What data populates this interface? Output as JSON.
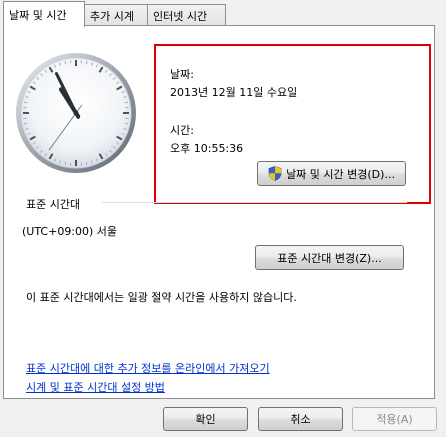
{
  "tabs": [
    {
      "label": "날짜 및 시간",
      "active": true
    },
    {
      "label": "추가 시계",
      "active": false
    },
    {
      "label": "인터넷 시간",
      "active": false
    }
  ],
  "datetime": {
    "date_label": "날짜:",
    "date_value": "2013년 12월 11일 수요일",
    "time_label": "시간:",
    "time_value": "오후 10:55:36",
    "change_button": "날짜 및 시간 변경(D)..."
  },
  "clock": {
    "hours": 10,
    "minutes": 55,
    "seconds": 36
  },
  "timezone": {
    "group_label": "표준 시간대",
    "value": "(UTC+09:00) 서울",
    "change_button": "표준 시간대 변경(Z)...",
    "dst_note": "이 표준 시간대에서는 일광 절약 시간을 사용하지 않습니다."
  },
  "links": [
    "표준 시간대에 대한 추가 정보를 온라인에서 가져오기",
    "시계 및 표준 시간대 설정 방법"
  ],
  "dialog_buttons": {
    "ok": "확인",
    "cancel": "취소",
    "apply": "적용(A)"
  },
  "colors": {
    "highlight_border": "#e00000",
    "link": "#0033cc"
  }
}
